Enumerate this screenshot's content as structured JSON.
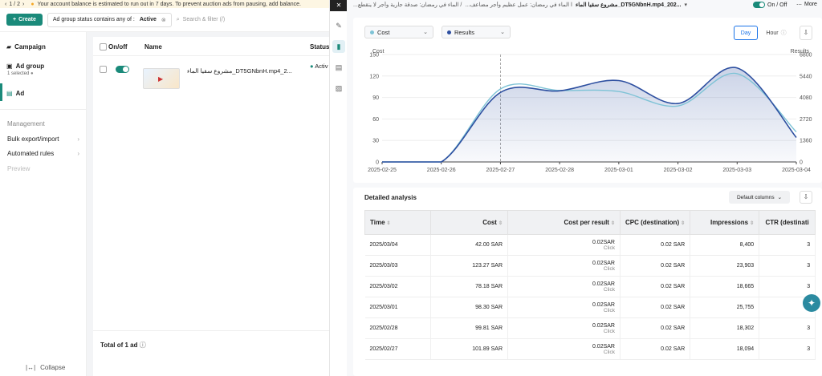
{
  "banner": {
    "page": "1 / 2",
    "message": "Your account balance is estimated to run out in 7 days. To prevent auction ads from pausing, add balance."
  },
  "toolbar": {
    "create_label": "Create",
    "filter_label": "Ad group status contains any of :",
    "filter_value": "Active",
    "search_placeholder": "Search & filter (/)"
  },
  "sidebar": {
    "campaign": "Campaign",
    "ad_group": "Ad group",
    "ad_group_sub": "1 selected",
    "ad": "Ad",
    "management": "Management",
    "bulk": "Bulk export/import",
    "rules": "Automated rules",
    "preview": "Preview",
    "collapse": "Collapse"
  },
  "midtable": {
    "col_onoff": "On/off",
    "col_name": "Name",
    "col_status": "Status",
    "row_name": "مشروع سقيا الماء_DT5GNbnH.mp4_2...",
    "row_status": "Activ",
    "total": "Total of 1 ad"
  },
  "detail": {
    "crumbs": [
      "...الماء في رمضان: صدقة جارية وأجر لا ينقطع /",
      "...ا الماء في رمضان: عمل عظيم وأجر مضاعف",
      "مشروع سقيا الماء_DT5GNbnH.mp4_202..."
    ],
    "onoff": "On / Off",
    "more": "More",
    "metric_left": "Cost",
    "metric_right": "Results",
    "day": "Day",
    "hour": "Hour",
    "detailed_title": "Detailed analysis",
    "default_columns": "Default columns",
    "colors": {
      "cost": "#7ec3d6",
      "results": "#2d4fa0"
    }
  },
  "chart_data": {
    "type": "line",
    "x": [
      "2025-02-25",
      "2025-02-26",
      "2025-02-27",
      "2025-02-28",
      "2025-03-01",
      "2025-03-02",
      "2025-03-03",
      "2025-03-04"
    ],
    "series": [
      {
        "name": "Cost",
        "axis": "left",
        "values": [
          0,
          0,
          101.89,
          99.81,
          98.3,
          78.18,
          123.27,
          42.0
        ]
      },
      {
        "name": "Results",
        "axis": "right",
        "values": [
          0,
          0,
          4400,
          4500,
          5150,
          3700,
          5950,
          1550
        ]
      }
    ],
    "ylabel": "Cost",
    "ylabel_right": "Results",
    "ylim": [
      0,
      150
    ],
    "ylim_right": [
      0,
      6800
    ],
    "yticks": [
      0,
      30,
      60,
      90,
      120,
      150
    ],
    "yticks_right": [
      0,
      1360,
      2720,
      4080,
      5440,
      6800
    ],
    "grid": true
  },
  "analysis_table": {
    "headers": [
      "Time",
      "Cost",
      "Cost per result",
      "CPC (destination)",
      "Impressions",
      "CTR (destinati"
    ],
    "rows": [
      {
        "time": "2025/03/04",
        "cost": "42.00 SAR",
        "cpr": "0.02SAR",
        "cpr_sub": "Click",
        "cpc": "0.02 SAR",
        "impr": "8,400",
        "ctr": "3"
      },
      {
        "time": "2025/03/03",
        "cost": "123.27 SAR",
        "cpr": "0.02SAR",
        "cpr_sub": "Click",
        "cpc": "0.02 SAR",
        "impr": "23,903",
        "ctr": "3"
      },
      {
        "time": "2025/03/02",
        "cost": "78.18 SAR",
        "cpr": "0.02SAR",
        "cpr_sub": "Click",
        "cpc": "0.02 SAR",
        "impr": "18,665",
        "ctr": "3"
      },
      {
        "time": "2025/03/01",
        "cost": "98.30 SAR",
        "cpr": "0.02SAR",
        "cpr_sub": "Click",
        "cpc": "0.02 SAR",
        "impr": "25,755",
        "ctr": "3"
      },
      {
        "time": "2025/02/28",
        "cost": "99.81 SAR",
        "cpr": "0.02SAR",
        "cpr_sub": "Click",
        "cpc": "0.02 SAR",
        "impr": "18,302",
        "ctr": "3"
      },
      {
        "time": "2025/02/27",
        "cost": "101.89 SAR",
        "cpr": "0.02SAR",
        "cpr_sub": "Click",
        "cpc": "0.02 SAR",
        "impr": "18,094",
        "ctr": "3"
      }
    ]
  }
}
